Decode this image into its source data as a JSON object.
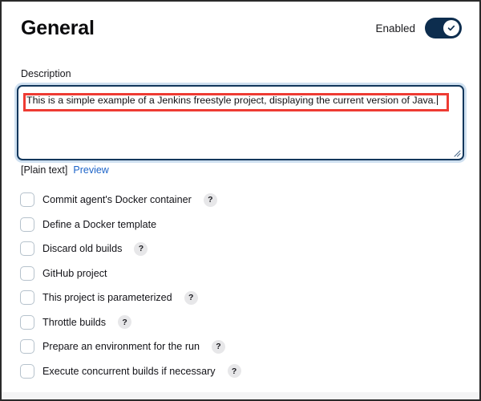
{
  "header": {
    "title": "General",
    "enabled_label": "Enabled",
    "toggle_state": "on",
    "toggle_icon": "check-icon",
    "toggle_color": "#0d2d4e"
  },
  "description": {
    "label": "Description",
    "value": "This is a simple example of a Jenkins freestyle project, displaying the current version of Java.",
    "placeholder": "",
    "focused": true,
    "border_color": "#12375c",
    "resize_handle_icon": "resize-grip-icon"
  },
  "annotation": {
    "type": "highlight-rectangle",
    "color": "#ee3b33"
  },
  "format_row": {
    "plain_text_label": "[Plain text]",
    "preview_label": "Preview",
    "preview_color": "#1d64c8"
  },
  "options": [
    {
      "label": "Commit agent's Docker container",
      "checked": false,
      "has_help": true
    },
    {
      "label": "Define a Docker template",
      "checked": false,
      "has_help": false
    },
    {
      "label": "Discard old builds",
      "checked": false,
      "has_help": true
    },
    {
      "label": "GitHub project",
      "checked": false,
      "has_help": false
    },
    {
      "label": "This project is parameterized",
      "checked": false,
      "has_help": true
    },
    {
      "label": "Throttle builds",
      "checked": false,
      "has_help": true
    },
    {
      "label": "Prepare an environment for the run",
      "checked": false,
      "has_help": true
    },
    {
      "label": "Execute concurrent builds if necessary",
      "checked": false,
      "has_help": true
    }
  ],
  "help_glyph": "?"
}
